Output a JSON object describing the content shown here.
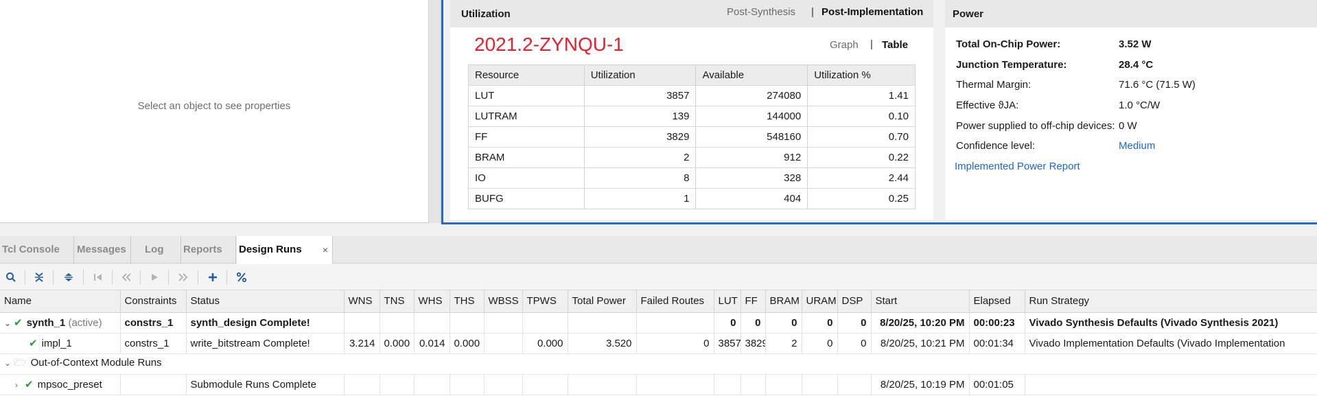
{
  "properties": {
    "empty_text": "Select an object to see properties"
  },
  "utilization": {
    "title": "Utilization",
    "tabs": [
      "Post-Synthesis",
      "|",
      "Post-Implementation"
    ],
    "part": "2021.2-ZYNQU-1",
    "views": [
      "Graph",
      "|",
      "Table"
    ],
    "columns": [
      "Resource",
      "Utilization",
      "Available",
      "Utilization %"
    ],
    "rows": [
      [
        "LUT",
        "3857",
        "274080",
        "1.41"
      ],
      [
        "LUTRAM",
        "139",
        "144000",
        "0.10"
      ],
      [
        "FF",
        "3829",
        "548160",
        "0.70"
      ],
      [
        "BRAM",
        "2",
        "912",
        "0.22"
      ],
      [
        "IO",
        "8",
        "328",
        "2.44"
      ],
      [
        "BUFG",
        "1",
        "404",
        "0.25"
      ]
    ]
  },
  "power": {
    "title": "Power",
    "rows": [
      {
        "k": "Total On-Chip Power:",
        "v": "3.52 W"
      },
      {
        "k": "Junction Temperature:",
        "v": "28.4 °C"
      },
      {
        "k": "Thermal Margin:",
        "v": "71.6 °C (71.5 W)"
      },
      {
        "k": "Effective ϑJA:",
        "v": "1.0 °C/W"
      },
      {
        "k": "Power supplied to off-chip devices:",
        "v": "0 W"
      },
      {
        "k": "Confidence level:",
        "v": "Medium"
      }
    ],
    "report_link": "Implemented Power Report"
  },
  "bottom_tabs": [
    "Tcl Console",
    "Messages",
    "Log",
    "Reports",
    "Design Runs"
  ],
  "close_glyph": "×",
  "runs": {
    "columns": [
      "Name",
      "Constraints",
      "Status",
      "WNS",
      "TNS",
      "WHS",
      "THS",
      "WBSS",
      "TPWS",
      "Total Power",
      "Failed Routes",
      "LUT",
      "FF",
      "BRAM",
      "URAM",
      "DSP",
      "Start",
      "Elapsed",
      "Run Strategy"
    ],
    "synth": {
      "name": "synth_1",
      "tag": "(active)",
      "constraints": "constrs_1",
      "status": "synth_design Complete!",
      "lut": "0",
      "ff": "0",
      "bram": "0",
      "uram": "0",
      "dsp": "0",
      "start": "8/20/25, 10:20 PM",
      "elapsed": "00:00:23",
      "strategy": "Vivado Synthesis Defaults (Vivado Synthesis 2021)"
    },
    "impl": {
      "name": "impl_1",
      "constraints": "constrs_1",
      "status": "write_bitstream Complete!",
      "wns": "3.214",
      "tns": "0.000",
      "whs": "0.014",
      "ths": "0.000",
      "tpws": "0.000",
      "power": "3.520",
      "failed": "0",
      "lut": "3857",
      "ff": "3829",
      "bram": "2",
      "uram": "0",
      "dsp": "0",
      "start": "8/20/25, 10:21 PM",
      "elapsed": "00:01:34",
      "strategy": "Vivado Implementation Defaults (Vivado Implementation"
    },
    "ooc_label": "Out-of-Context Module Runs",
    "mpsoc": {
      "name": "mpsoc_preset",
      "status": "Submodule Runs Complete",
      "start": "8/20/25, 10:19 PM",
      "elapsed": "00:01:05"
    }
  }
}
